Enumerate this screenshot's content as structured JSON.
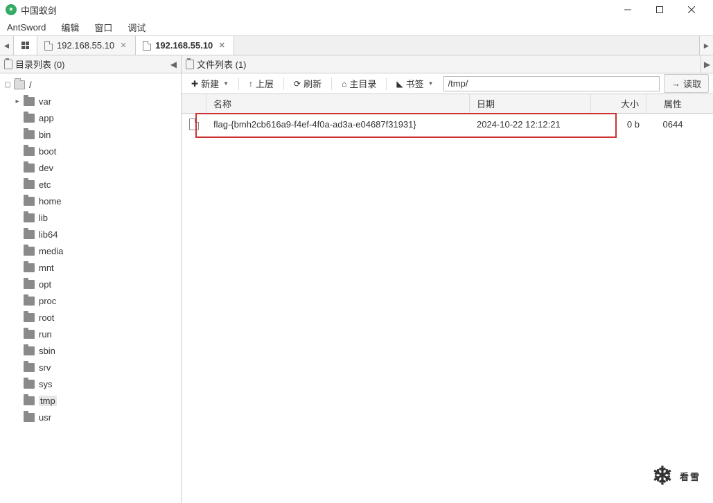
{
  "window": {
    "title": "中国蚁剑"
  },
  "menubar": {
    "app": "AntSword",
    "edit": "编辑",
    "window": "窗口",
    "debug": "调试"
  },
  "tabs": {
    "tab1": "192.168.55.10",
    "tab2": "192.168.55.10"
  },
  "left_pane": {
    "title": "目录列表 (0)"
  },
  "tree": {
    "root": "/",
    "items": [
      "var",
      "app",
      "bin",
      "boot",
      "dev",
      "etc",
      "home",
      "lib",
      "lib64",
      "media",
      "mnt",
      "opt",
      "proc",
      "root",
      "run",
      "sbin",
      "srv",
      "sys",
      "tmp",
      "usr"
    ]
  },
  "right_pane": {
    "title": "文件列表 (1)"
  },
  "toolbar": {
    "new": "新建",
    "up": "上层",
    "refresh": "刷新",
    "home": "主目录",
    "bookmark": "书签",
    "path": "/tmp/",
    "read": "读取"
  },
  "columns": {
    "name": "名称",
    "date": "日期",
    "size": "大小",
    "attr": "属性"
  },
  "files": [
    {
      "name": "flag-{bmh2cb616a9-f4ef-4f0a-ad3a-e04687f31931}",
      "date": "2024-10-22 12:12:21",
      "size": "0 b",
      "attr": "0644"
    }
  ],
  "watermark": "看雪"
}
